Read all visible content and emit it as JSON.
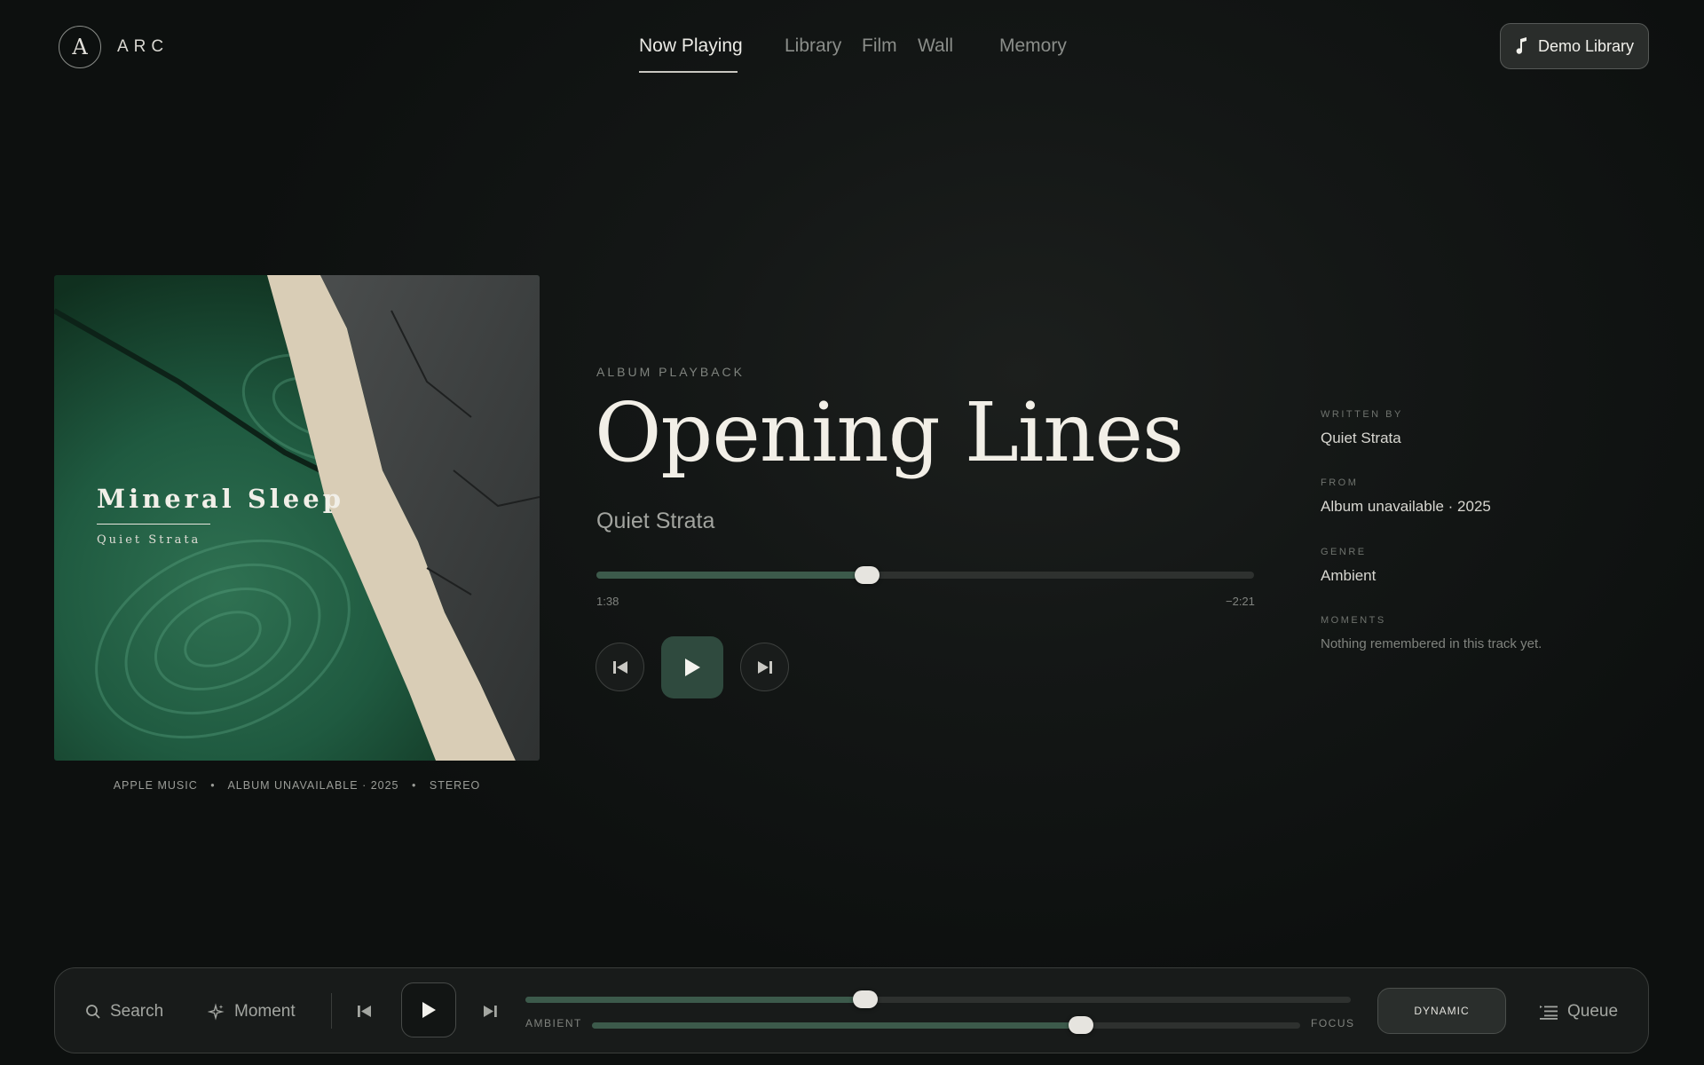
{
  "brand": {
    "mark": "A",
    "name": "ARC"
  },
  "nav": {
    "items": [
      {
        "label": "Now Playing",
        "active": true
      },
      {
        "label": "Library",
        "active": false
      },
      {
        "label": "Film",
        "active": false
      },
      {
        "label": "Wall",
        "active": false
      },
      {
        "label": "Memory",
        "active": false
      }
    ],
    "library_button": "Demo Library"
  },
  "album": {
    "title": "Mineral Sleep",
    "artist": "Quiet Strata",
    "meta": [
      "APPLE MUSIC",
      "ALBUM UNAVAILABLE · 2025",
      "STEREO"
    ],
    "meta_separator": "•"
  },
  "track": {
    "eyebrow": "ALBUM PLAYBACK",
    "title": "Opening Lines",
    "artist": "Quiet Strata",
    "elapsed": "1:38",
    "remaining": "−2:21",
    "progress_fraction": 0.412
  },
  "details": [
    {
      "label": "WRITTEN BY",
      "value": "Quiet Strata"
    },
    {
      "label": "FROM",
      "value": "Album unavailable · 2025"
    },
    {
      "label": "GENRE",
      "value": "Ambient"
    },
    {
      "label": "MOMENTS",
      "value": "Nothing remembered in this track yet."
    }
  ],
  "dock": {
    "search_label": "Search",
    "moment_label": "Moment",
    "playback_progress_fraction": 0.412,
    "mix_left_label": "AMBIENT",
    "mix_right_label": "FOCUS",
    "mix_fraction": 0.69,
    "mode_label": "DYNAMIC",
    "queue_label": "Queue"
  },
  "colors": {
    "accent": "#3c5a4b",
    "play_button": "#2f4a3e",
    "background": "#141716"
  }
}
